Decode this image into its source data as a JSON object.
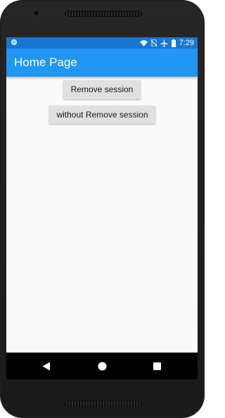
{
  "status_bar": {
    "time": "7:29",
    "icons": [
      "notification-dot-icon",
      "wifi-icon",
      "no-sim-icon",
      "airplane-mode-icon",
      "battery-icon"
    ],
    "background": "#1976d2"
  },
  "app_bar": {
    "title": "Home Page",
    "background": "#2196f3"
  },
  "main": {
    "buttons": [
      {
        "label": "Remove session"
      },
      {
        "label": "without Remove session"
      }
    ],
    "background": "#fafafa"
  },
  "nav_bar": {
    "icons": [
      "back-icon",
      "home-icon",
      "recents-icon"
    ],
    "background": "#000000"
  }
}
